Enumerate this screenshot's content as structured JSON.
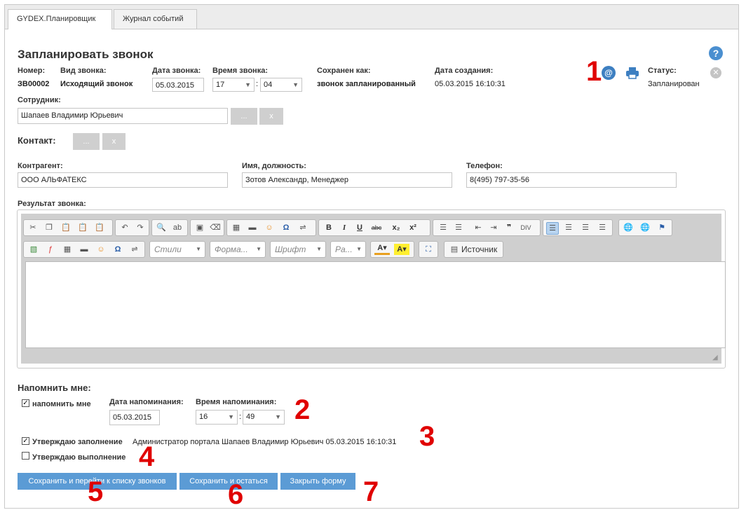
{
  "tabs": [
    {
      "label": "GYDEX.Планировщик",
      "active": true
    },
    {
      "label": "Журнал событий",
      "active": false
    }
  ],
  "form": {
    "title": "Запланировать звонок",
    "number": {
      "label": "Номер:",
      "value": "ЗВ00002"
    },
    "call_type": {
      "label": "Вид звонка:",
      "value": "Исходящий звонок"
    },
    "call_date": {
      "label": "Дата звонка:",
      "value": "05.03.2015"
    },
    "call_time": {
      "label": "Время звонка:",
      "hour": "17",
      "minute": "04",
      "separator": ":"
    },
    "saved_as": {
      "label": "Сохранен как:",
      "value": "звонок запланированный"
    },
    "created": {
      "label": "Дата создания:",
      "value": "05.03.2015 16:10:31"
    },
    "status": {
      "label": "Статус:",
      "value": "Запланирован"
    },
    "employee": {
      "label": "Сотрудник:",
      "value": "Шапаев Владимир Юрьевич",
      "pick_label": "...",
      "clear_label": "x"
    },
    "contact": {
      "label": "Контакт:",
      "pick_label": "...",
      "clear_label": "x"
    },
    "counterparty": {
      "label": "Контрагент:",
      "value": "ООО АЛЬФАТЕКС"
    },
    "name_position": {
      "label": "Имя, должность:",
      "value": "Зотов Александр, Менеджер"
    },
    "phone": {
      "label": "Телефон:",
      "value": "8(495) 797-35-56"
    },
    "result": {
      "label": "Результат звонка:"
    }
  },
  "editor": {
    "combos": [
      "Стили",
      "Форма...",
      "Шрифт",
      "Ра..."
    ],
    "source_label": "Источник",
    "row1_icons": [
      "cut-icon",
      "copy-icon",
      "paste-icon",
      "paste-text-icon",
      "paste-word-icon",
      "undo-icon",
      "redo-icon",
      "find-icon",
      "replace-icon",
      "select-all-icon",
      "remove-format-icon",
      "table-icon",
      "horizontal-line-icon",
      "smiley-icon",
      "special-char-icon",
      "page-break-icon",
      "bold-icon",
      "italic-icon",
      "underline-icon",
      "strike-icon",
      "subscript-icon",
      "superscript-icon",
      "ordered-list-icon",
      "bullet-list-icon",
      "outdent-icon",
      "indent-icon",
      "blockquote-icon",
      "div-icon",
      "align-left-icon",
      "align-center-icon",
      "align-right-icon",
      "justify-icon",
      "link-icon",
      "unlink-icon",
      "anchor-icon"
    ],
    "row2_icons": [
      "image-icon",
      "flash-icon",
      "table-icon",
      "horizontal-line-icon",
      "smiley-icon",
      "special-char-icon",
      "page-break-icon",
      "text-color-icon",
      "bg-color-icon",
      "maximize-icon",
      "source-icon"
    ]
  },
  "reminder": {
    "heading": "Напомнить мне:",
    "checkbox_label": "напомнить мне",
    "checked": true,
    "date": {
      "label": "Дата напоминания:",
      "value": "05.03.2015"
    },
    "time": {
      "label": "Время напоминания:",
      "hour": "16",
      "minute": "49",
      "separator": ":"
    }
  },
  "approve_fill": {
    "label": "Утверждаю заполнение",
    "checked": true,
    "detail": "Администратор портала Шапаев Владимир Юрьевич 05.03.2015 16:10:31"
  },
  "approve_done": {
    "label": "Утверждаю выполнение",
    "checked": false
  },
  "buttons": {
    "save_and_go": "Сохранить и перейти к списку звонков",
    "save_and_stay": "Сохранить и остаться",
    "close": "Закрыть форму"
  },
  "annotations": [
    "1",
    "2",
    "3",
    "4",
    "5",
    "6",
    "7"
  ],
  "colors": {
    "accent_blue": "#5b9bd5",
    "annotation_red": "#e00000",
    "gray_button": "#cfcfcf"
  }
}
